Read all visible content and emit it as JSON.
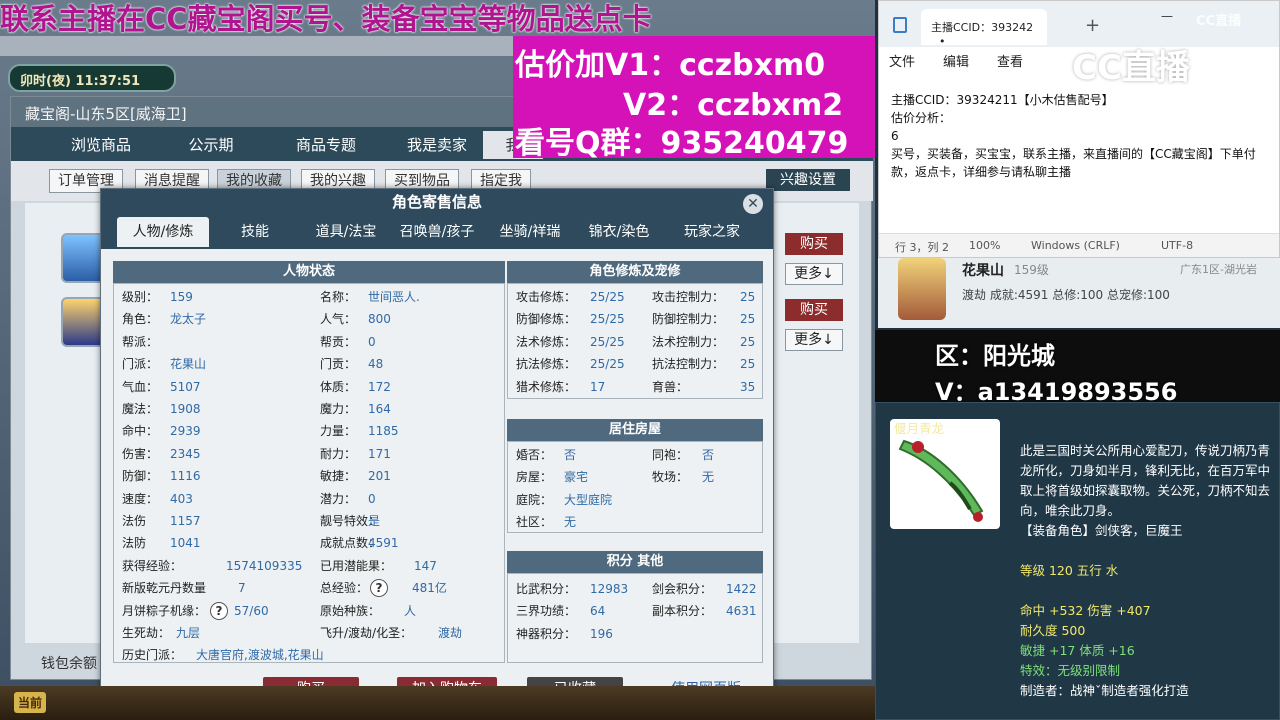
{
  "banner": {
    "top": "联系主播在CC藏宝阁买号、装备宝宝等物品送点卡",
    "v1": "估价加V1：cczbxm0",
    "v2": "V2：cczbxm2",
    "qq": "看号Q群：935240479"
  },
  "game": {
    "clock": "卯时(夜) 11:37:51",
    "bottom_current": "当前"
  },
  "shop": {
    "title": "藏宝阁-山东5区[威海卫]",
    "tabs": [
      "浏览商品",
      "公示期",
      "商品专题",
      "我是卖家",
      "我"
    ],
    "subtabs": [
      "订单管理",
      "消息提醒",
      "我的收藏",
      "我的兴趣",
      "买到物品",
      "指定我"
    ],
    "interest_button": "兴趣设置",
    "buy_label": "购买",
    "more_label": "更多↓",
    "wallet": "钱包余额"
  },
  "dialog": {
    "title": "角色寄售信息",
    "tabs": [
      "人物/修炼",
      "技能",
      "道具/法宝",
      "召唤兽/孩子",
      "坐骑/祥瑞",
      "锦衣/染色",
      "玩家之家"
    ],
    "status_header": "人物状态",
    "cultivation_header": "角色修炼及宠修",
    "house_header": "居住房屋",
    "points_header": "积分 其他",
    "left_rows": [
      {
        "l1": "级别：",
        "v1": "159",
        "l2": "名称：",
        "v2": "世间恶人."
      },
      {
        "l1": "角色：",
        "v1": "龙太子",
        "l2": "人气：",
        "v2": "800"
      },
      {
        "l1": "帮派：",
        "v1": "",
        "l2": "帮贡：",
        "v2": "0"
      },
      {
        "l1": "门派：",
        "v1": "花果山",
        "l2": "门贡：",
        "v2": "48"
      },
      {
        "l1": "气血：",
        "v1": "5107",
        "l2": "体质：",
        "v2": "172"
      },
      {
        "l1": "魔法：",
        "v1": "1908",
        "l2": "魔力：",
        "v2": "164"
      },
      {
        "l1": "命中：",
        "v1": "2939",
        "l2": "力量：",
        "v2": "1185"
      },
      {
        "l1": "伤害：",
        "v1": "2345",
        "l2": "耐力：",
        "v2": "171"
      },
      {
        "l1": "防御：",
        "v1": "1116",
        "l2": "敏捷：",
        "v2": "201"
      },
      {
        "l1": "速度：",
        "v1": "403",
        "l2": "潜力：",
        "v2": "0"
      },
      {
        "l1": "法伤",
        "v1": "1157",
        "l2": "靓号特效：",
        "v2": "是"
      },
      {
        "l1": "法防",
        "v1": "1041",
        "l2": "成就点数：",
        "v2": "4591"
      },
      {
        "l1": "获得经验：",
        "v1": "1574109335",
        "l2": "已用潜能果：",
        "v2": "147"
      },
      {
        "l1": "新版乾元丹数量",
        "v1": "7",
        "l2": "总经验：",
        "v2": "481亿"
      },
      {
        "l1": "月饼粽子机缘：",
        "v1": "57/60",
        "l2": "原始种族：",
        "v2": "人"
      },
      {
        "l1": "生死劫：",
        "v1": "九层",
        "l2": "飞升/渡劫/化圣：",
        "v2": "渡劫"
      }
    ],
    "history_label": "历史门派：",
    "history_value": "大唐官府,渡波城,花果山",
    "cult_rows": [
      {
        "l1": "攻击修炼：",
        "v1": "25/25",
        "l2": "攻击控制力：",
        "v2": "25"
      },
      {
        "l1": "防御修炼：",
        "v1": "25/25",
        "l2": "防御控制力：",
        "v2": "25"
      },
      {
        "l1": "法术修炼：",
        "v1": "25/25",
        "l2": "法术控制力：",
        "v2": "25"
      },
      {
        "l1": "抗法修炼：",
        "v1": "25/25",
        "l2": "抗法控制力：",
        "v2": "25"
      },
      {
        "l1": "猎术修炼：",
        "v1": "17",
        "l2": "育兽：",
        "v2": "35"
      }
    ],
    "house_rows": [
      {
        "l1": "婚否：",
        "v1": "否",
        "l2": "同袍：",
        "v2": "否"
      },
      {
        "l1": "房屋：",
        "v1": "豪宅",
        "l2": "牧场：",
        "v2": "无"
      },
      {
        "l1": "庭院：",
        "v1": "大型庭院",
        "l2": "",
        "v2": ""
      },
      {
        "l1": "社区：",
        "v1": "无",
        "l2": "",
        "v2": ""
      }
    ],
    "point_rows": [
      {
        "l1": "比武积分：",
        "v1": "12983",
        "l2": "剑会积分：",
        "v2": "1422"
      },
      {
        "l1": "三界功绩：",
        "v1": "64",
        "l2": "副本积分：",
        "v2": "4631"
      },
      {
        "l1": "神器积分：",
        "v1": "196",
        "l2": "",
        "v2": ""
      }
    ],
    "buttons": {
      "buy": "购买",
      "cart": "加入购物车",
      "favorited": "已收藏",
      "web": "使用网页版"
    },
    "qmark": "?"
  },
  "notepad": {
    "tab_title": "主播CCID：393242",
    "tab_close": "•",
    "new_tab": "+",
    "menu": [
      "文件",
      "编辑",
      "查看"
    ],
    "lines": [
      "主播CCID：39324211【小木估售配号】",
      "估价分析：",
      "6",
      "买号，买装备，买宝宝，联系主播，来直播间的【CC藏宝阁】下单付款，返点卡，详细参与请私聊主播"
    ],
    "status": [
      "行 3，列 2",
      "100%",
      "Windows (CRLF)",
      "UTF-8"
    ],
    "window_controls": [
      "—",
      "☐",
      "✕"
    ],
    "watermark": "CC直播"
  },
  "right_card": {
    "server": "花果山",
    "level": "159级",
    "region": "广东1区-湖光岩",
    "summary": "渡劫 成就:4591 总修:100 总宠修:100"
  },
  "right_overlay": {
    "zone": "区：阳光城",
    "v": "V：a13419893556"
  },
  "item": {
    "name": "偃月青龙",
    "desc": "此是三国时关公所用心爱配刀，传说刀柄乃青龙所化，刀身如半月，锋利无比，在百万军中取上将首级如探囊取物。关公死，刀柄不知去向，唯余此刀身。",
    "role": "【装备角色】剑侠客，巨魔王",
    "level": "等级 120 五行 水",
    "stat1": "命中 +532 伤害 +407",
    "durability": "耐久度 500",
    "stat2": "敏捷 +17 体质 +16",
    "effect": "特效：无级别限制",
    "maker": "制造者：战神ˇ制造者强化打造"
  }
}
